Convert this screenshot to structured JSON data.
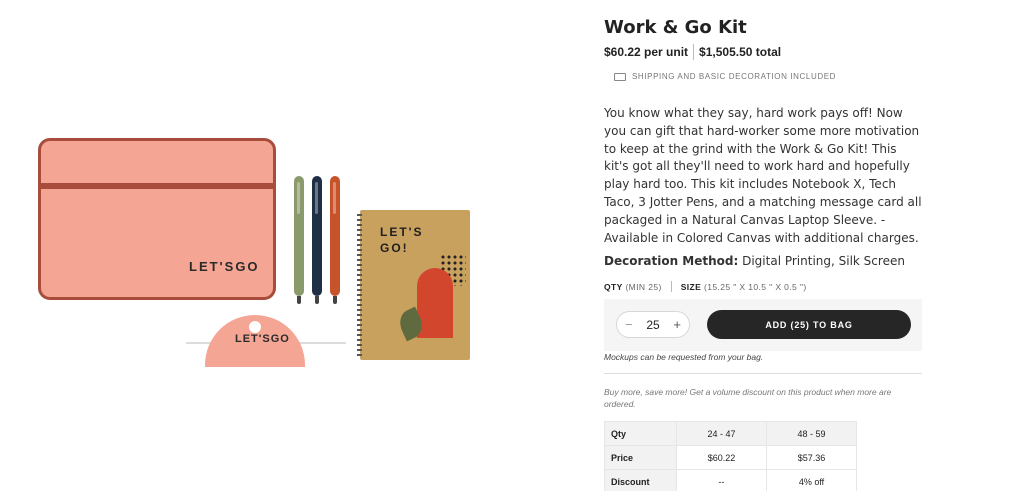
{
  "product": {
    "title": "Work & Go Kit",
    "price_per_unit": "$60.22 per unit",
    "price_total": "$1,505.50 total",
    "shipping_note": "SHIPPING AND BASIC DECORATION INCLUDED",
    "description": "You know what they say, hard work pays off! Now you can gift that hard-worker some more motivation to keep at the grind with the Work & Go Kit! This kit's got all they'll need to work hard and hopefully play hard too. This kit includes Notebook X, Tech Taco, 3 Jotter Pens, and a matching message card all packaged in a Natural Canvas Laptop Sleeve. - Available in Colored Canvas with additional charges.",
    "decoration_label": "Decoration Method:",
    "decoration_value": "Digital Printing, Silk Screen",
    "image": {
      "sleeve_logo": "LET'SGO",
      "notebook_title": "LET'S\nGO!",
      "taco_logo": "LET'SGO",
      "colors": {
        "sleeve": "#f4a593",
        "sleeve_trim": "#a84d3c",
        "pen_green": "#8a9a6b",
        "pen_navy": "#1f2f46",
        "pen_rust": "#c7532a",
        "notebook": "#c9a15e",
        "notebook_arch": "#d3462e",
        "notebook_leaf": "#5f6a3e"
      }
    }
  },
  "order": {
    "qty_label": "QTY",
    "qty_min": "(MIN 25)",
    "size_label": "SIZE",
    "size_value": "(15.25 \" X 10.5 \" X 0.5 \")",
    "quantity": "25",
    "minus": "−",
    "plus": "+",
    "add_button": "ADD (25) TO BAG",
    "mockup_note": "Mockups can be requested from your bag.",
    "volume_note": "Buy more, save more! Get a volume discount on this product when more are ordered."
  },
  "tiers": {
    "rows": [
      {
        "label": "Qty",
        "values": [
          "24 - 47",
          "48 - 59"
        ]
      },
      {
        "label": "Price",
        "values": [
          "$60.22",
          "$57.36"
        ]
      },
      {
        "label": "Discount",
        "values": [
          "--",
          "4% off"
        ]
      }
    ]
  },
  "icons": {
    "shipping": "truck-icon"
  }
}
